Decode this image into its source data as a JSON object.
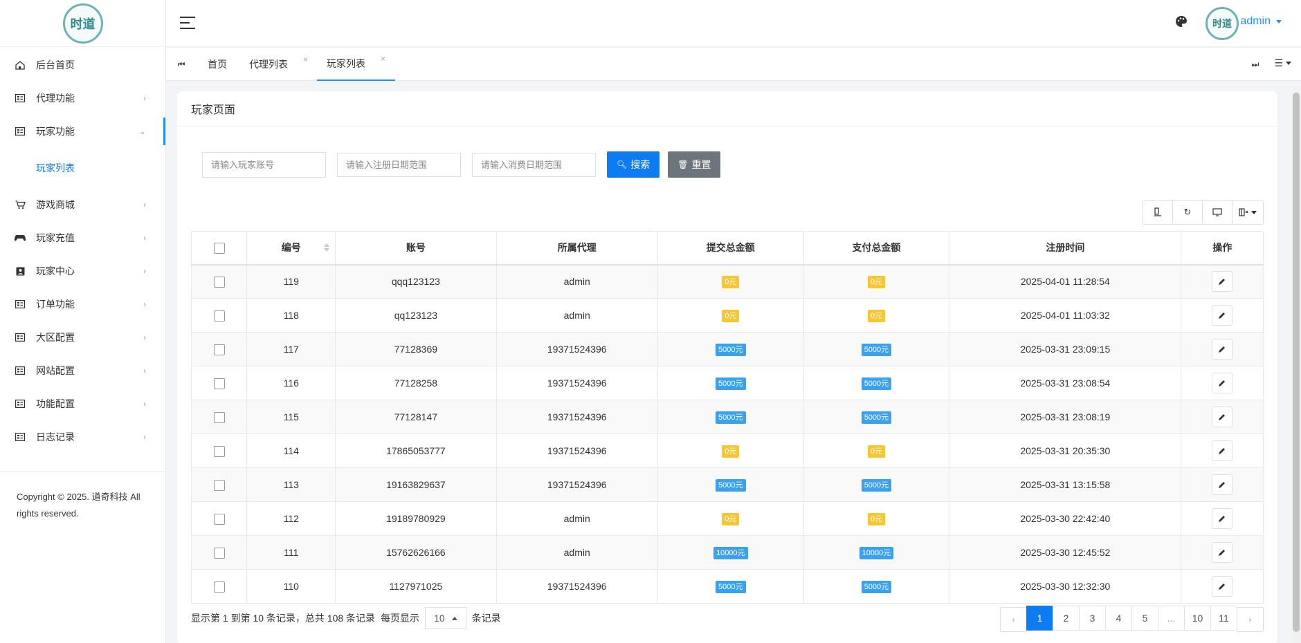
{
  "sidebar": {
    "logo_text": "时道",
    "items": [
      {
        "label": "后台首页",
        "icon": "home-icon",
        "has_chevron": false
      },
      {
        "label": "代理功能",
        "icon": "grid-icon",
        "has_chevron": true
      },
      {
        "label": "玩家功能",
        "icon": "grid-icon",
        "has_chevron": true,
        "open": true
      },
      {
        "label": "游戏商城",
        "icon": "cart-icon",
        "has_chevron": true
      },
      {
        "label": "玩家充值",
        "icon": "gamepad-icon",
        "has_chevron": true
      },
      {
        "label": "玩家中心",
        "icon": "person-card-icon",
        "has_chevron": true
      },
      {
        "label": "订单功能",
        "icon": "grid-icon",
        "has_chevron": true
      },
      {
        "label": "大区配置",
        "icon": "grid-icon",
        "has_chevron": true
      },
      {
        "label": "网站配置",
        "icon": "grid-icon",
        "has_chevron": true
      },
      {
        "label": "功能配置",
        "icon": "grid-icon",
        "has_chevron": true
      },
      {
        "label": "日志记录",
        "icon": "grid-icon",
        "has_chevron": true
      }
    ],
    "sub_item": "玩家列表",
    "copyright_line1": "Copyright © 2025. 道奇科技 All",
    "copyright_line2": "rights reserved."
  },
  "header": {
    "user": "admin",
    "avatar_text": "时道"
  },
  "tabs": [
    {
      "label": "首页",
      "closable": false
    },
    {
      "label": "代理列表",
      "closable": true
    },
    {
      "label": "玩家列表",
      "closable": true,
      "active": true
    }
  ],
  "page": {
    "title": "玩家页面",
    "filters": {
      "account_placeholder": "请输入玩家账号",
      "register_placeholder": "请输入注册日期范围",
      "consume_placeholder": "请输入消费日期范围"
    },
    "search_label": "搜索",
    "reset_label": "重置"
  },
  "table": {
    "columns": [
      "编号",
      "账号",
      "所属代理",
      "提交总金额",
      "支付总金额",
      "注册时间",
      "操作"
    ],
    "rows": [
      {
        "id": "119",
        "account": "qqq123123",
        "agent": "admin",
        "submit": "0元",
        "pay": "0元",
        "time": "2025-04-01 11:28:54"
      },
      {
        "id": "118",
        "account": "qq123123",
        "agent": "admin",
        "submit": "0元",
        "pay": "0元",
        "time": "2025-04-01 11:03:32"
      },
      {
        "id": "117",
        "account": "77128369",
        "agent": "19371524396",
        "submit": "5000元",
        "pay": "5000元",
        "time": "2025-03-31 23:09:15"
      },
      {
        "id": "116",
        "account": "77128258",
        "agent": "19371524396",
        "submit": "5000元",
        "pay": "5000元",
        "time": "2025-03-31 23:08:54"
      },
      {
        "id": "115",
        "account": "77128147",
        "agent": "19371524396",
        "submit": "5000元",
        "pay": "5000元",
        "time": "2025-03-31 23:08:19"
      },
      {
        "id": "114",
        "account": "17865053777",
        "agent": "19371524396",
        "submit": "0元",
        "pay": "0元",
        "time": "2025-03-31 20:35:30"
      },
      {
        "id": "113",
        "account": "19163829637",
        "agent": "19371524396",
        "submit": "5000元",
        "pay": "5000元",
        "time": "2025-03-31 13:15:58"
      },
      {
        "id": "112",
        "account": "19189780929",
        "agent": "admin",
        "submit": "0元",
        "pay": "0元",
        "time": "2025-03-30 22:42:40"
      },
      {
        "id": "111",
        "account": "15762626166",
        "agent": "admin",
        "submit": "10000元",
        "pay": "10000元",
        "time": "2025-03-30 12:45:52"
      },
      {
        "id": "110",
        "account": "1127971025",
        "agent": "19371524396",
        "submit": "5000元",
        "pay": "5000元",
        "time": "2025-03-30 12:32:30"
      }
    ]
  },
  "pagination": {
    "info_prefix": "显示第 1 到第 10 条记录，总共 108 条记录",
    "per_page_label": "每页显示",
    "page_size": "10",
    "suffix": "条记录",
    "prev": "‹",
    "next": "›",
    "pages": [
      "1",
      "2",
      "3",
      "4",
      "5",
      "...",
      "10",
      "11"
    ],
    "current": "1"
  },
  "colors": {
    "primary": "#0d7bf2",
    "badge_zero": "#f8c630",
    "badge_amount": "#3aa0f0"
  }
}
